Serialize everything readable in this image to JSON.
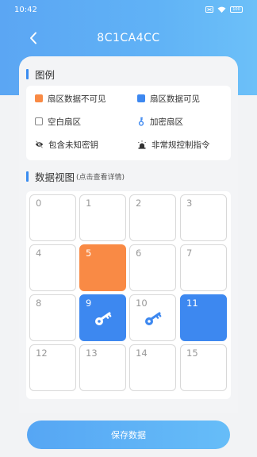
{
  "status_bar": {
    "time": "10:42",
    "battery": "100"
  },
  "nav": {
    "title": "8C1CA4CC"
  },
  "legend_section": {
    "title": "图例"
  },
  "legend": {
    "items": [
      {
        "label": "扇区数据不可见",
        "icon": "orange-square-icon",
        "color": "#f98a45"
      },
      {
        "label": "扇区数据可见",
        "icon": "blue-square-icon",
        "color": "#3d88f0"
      },
      {
        "label": "空白扇区",
        "icon": "empty-square-icon"
      },
      {
        "label": "加密扇区",
        "icon": "key-icon",
        "color": "#3d88f0"
      },
      {
        "label": "包含未知密钥",
        "icon": "eye-slash-icon"
      },
      {
        "label": "非常规控制指令",
        "icon": "alarm-light-icon"
      }
    ]
  },
  "data_view": {
    "title": "数据视图",
    "hint": "(点击查看详情)"
  },
  "sectors": [
    {
      "label": "0",
      "state": "empty"
    },
    {
      "label": "1",
      "state": "empty"
    },
    {
      "label": "2",
      "state": "empty"
    },
    {
      "label": "3",
      "state": "empty"
    },
    {
      "label": "4",
      "state": "empty"
    },
    {
      "label": "5",
      "state": "orange"
    },
    {
      "label": "6",
      "state": "empty"
    },
    {
      "label": "7",
      "state": "empty"
    },
    {
      "label": "8",
      "state": "empty"
    },
    {
      "label": "9",
      "state": "blue",
      "icon": "key-icon"
    },
    {
      "label": "10",
      "state": "empty",
      "icon": "key-icon"
    },
    {
      "label": "11",
      "state": "blue"
    },
    {
      "label": "12",
      "state": "empty"
    },
    {
      "label": "13",
      "state": "empty"
    },
    {
      "label": "14",
      "state": "empty"
    },
    {
      "label": "15",
      "state": "empty"
    }
  ],
  "save_button": {
    "label": "保存数据"
  },
  "colors": {
    "accent": "#3d88f0",
    "warning": "#f98a45",
    "header_start": "#5ba6f3",
    "header_end": "#6cc0f8"
  }
}
